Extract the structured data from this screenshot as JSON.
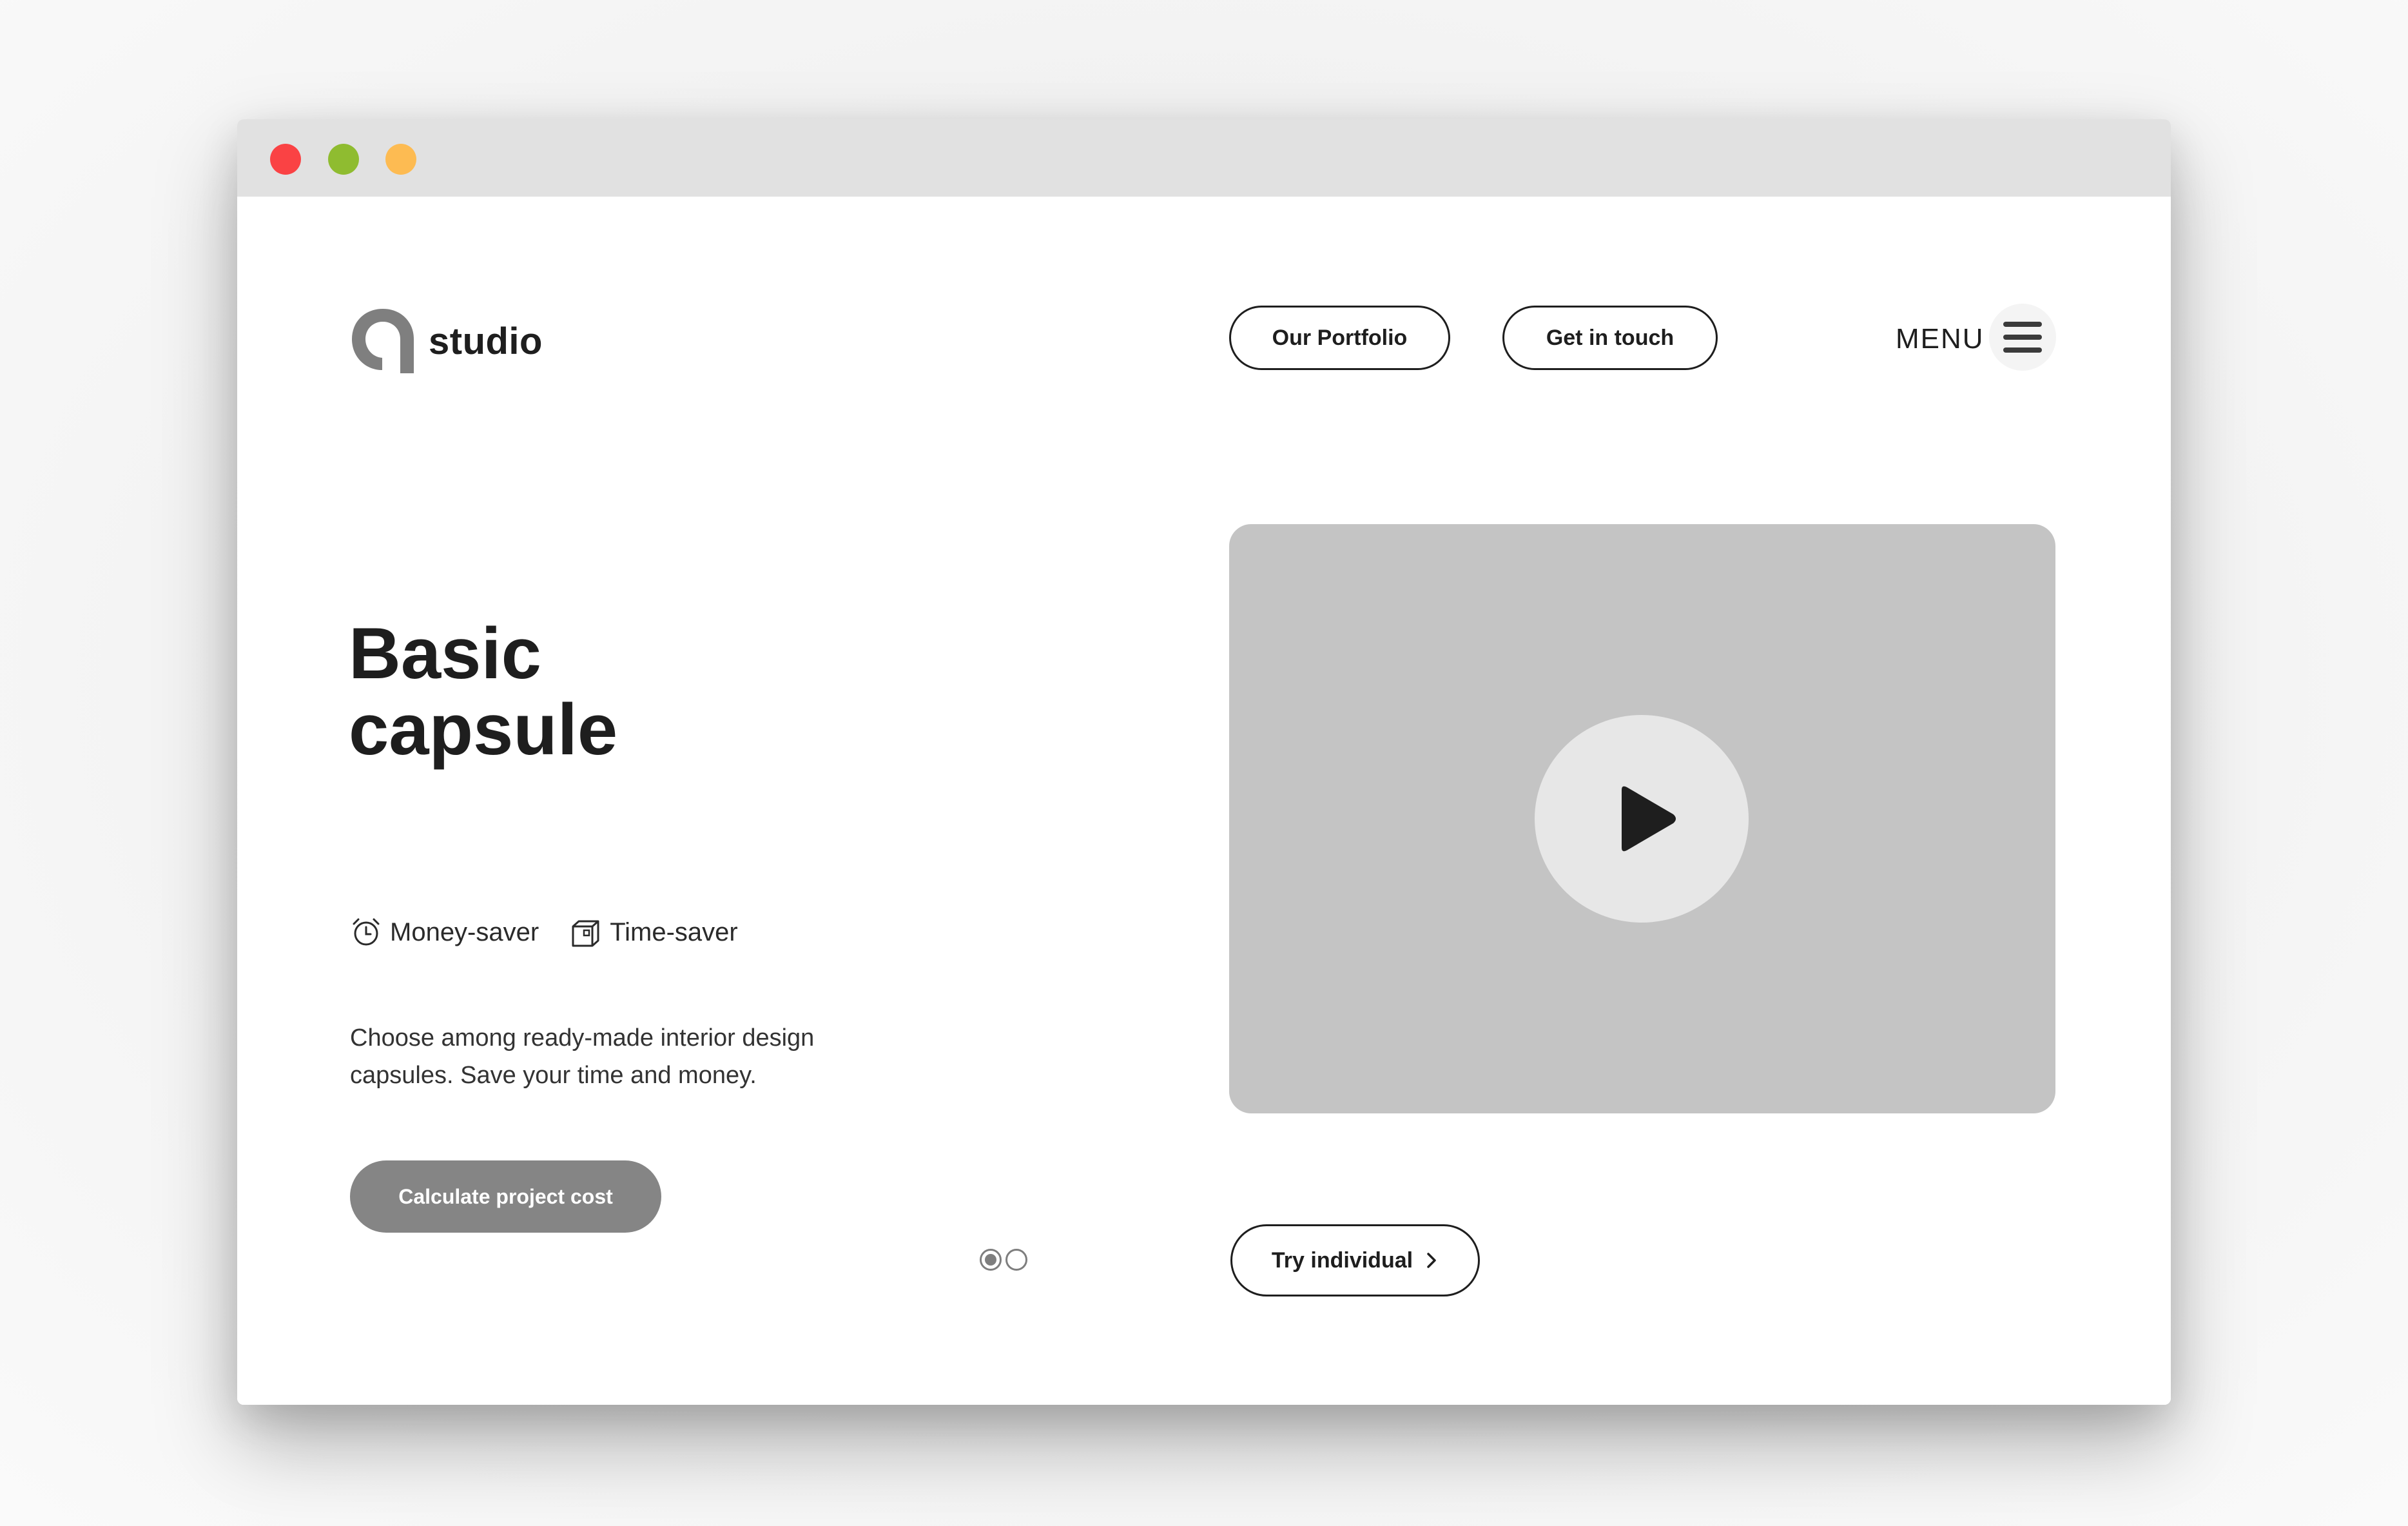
{
  "window": {
    "controls": [
      "close",
      "minimize",
      "maximize"
    ]
  },
  "header": {
    "logo_text": "studio",
    "nav": {
      "portfolio_label": "Our Portfolio",
      "contact_label": "Get in touch"
    },
    "menu_label": "MENU"
  },
  "hero": {
    "title_line1": "Basic",
    "title_line2": "capsule",
    "features": [
      {
        "label": "Money-saver",
        "icon": "alarm-clock-icon"
      },
      {
        "label": "Time-saver",
        "icon": "box-icon"
      }
    ],
    "description": "Choose among ready-made interior design\ncapsules.  Save your time and money.",
    "cta_label": "Calculate project cost"
  },
  "media": {
    "play_icon": "play-icon"
  },
  "pager": {
    "count": 2,
    "active_index": 0
  },
  "secondary_cta": {
    "label": "Try individual"
  },
  "colors": {
    "close": "#fa4244",
    "minimize": "#8fbc30",
    "maximize": "#fdbb52",
    "text_dark": "#1e1e1e",
    "cta_bg": "#858585",
    "video_bg": "#c4c4c4"
  }
}
